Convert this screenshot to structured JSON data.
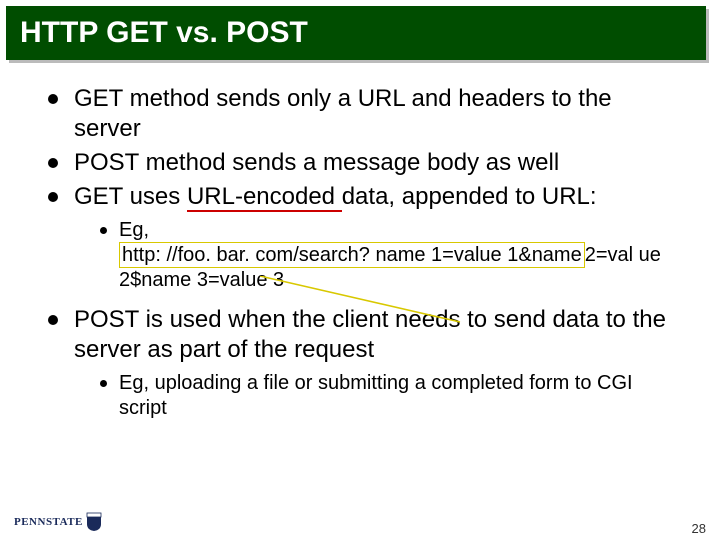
{
  "title": "HTTP GET vs. POST",
  "bullets": [
    {
      "text": "GET method sends only a URL and headers to the server"
    },
    {
      "text": "POST method sends a message body as well"
    },
    {
      "text_before": "GET uses ",
      "underlined": "URL-encoded ",
      "text_after": "data, appended to URL:"
    }
  ],
  "sub1": {
    "label": "Eg,",
    "url_boxed": "http: //foo. bar. com/search? name 1=value 1&name",
    "url_tail": "2=val ue 2$name 3=value 3"
  },
  "bullet4": "POST is used when the client needs to send data to the server as part of the request",
  "sub2": {
    "text": "Eg, uploading a file or submitting a completed form to CGI script"
  },
  "logo_text": "PENNSTATE",
  "page_number": "28"
}
